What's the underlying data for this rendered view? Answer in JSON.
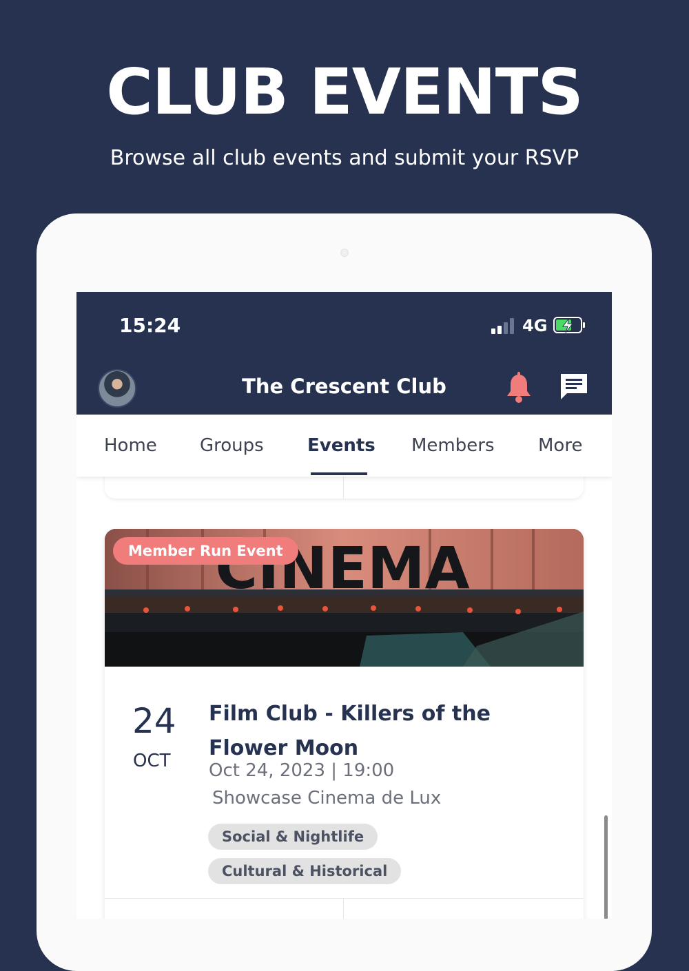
{
  "promo": {
    "title": "CLUB EVENTS",
    "subtitle": "Browse all club events and submit your RSVP"
  },
  "status_bar": {
    "time": "15:24",
    "network": "4G",
    "signal_bars_filled": 2,
    "signal_bars_total": 4,
    "battery": "charging"
  },
  "header": {
    "club_name": "The Crescent Club",
    "icons": [
      "avatar",
      "bell-icon",
      "chat-icon"
    ],
    "bell_color": "#f07c7c"
  },
  "tabs": [
    {
      "label": "Home",
      "active": false
    },
    {
      "label": "Groups",
      "active": false
    },
    {
      "label": "Events",
      "active": true
    },
    {
      "label": "Members",
      "active": false
    },
    {
      "label": "More",
      "active": false
    }
  ],
  "event": {
    "badge": "Member Run Event",
    "image_sign": "CINEMA",
    "day": "24",
    "month": "OCT",
    "title": "Film Club - Killers of the Flower Moon",
    "datetime": "Oct 24, 2023 | 19:00",
    "venue": "Showcase Cinema de Lux",
    "tags": [
      "Social & Nightlife",
      "Cultural & Historical"
    ]
  },
  "colors": {
    "navy": "#26324f",
    "accent_coral": "#f07c7c",
    "tag_bg": "#e2e2e2"
  }
}
